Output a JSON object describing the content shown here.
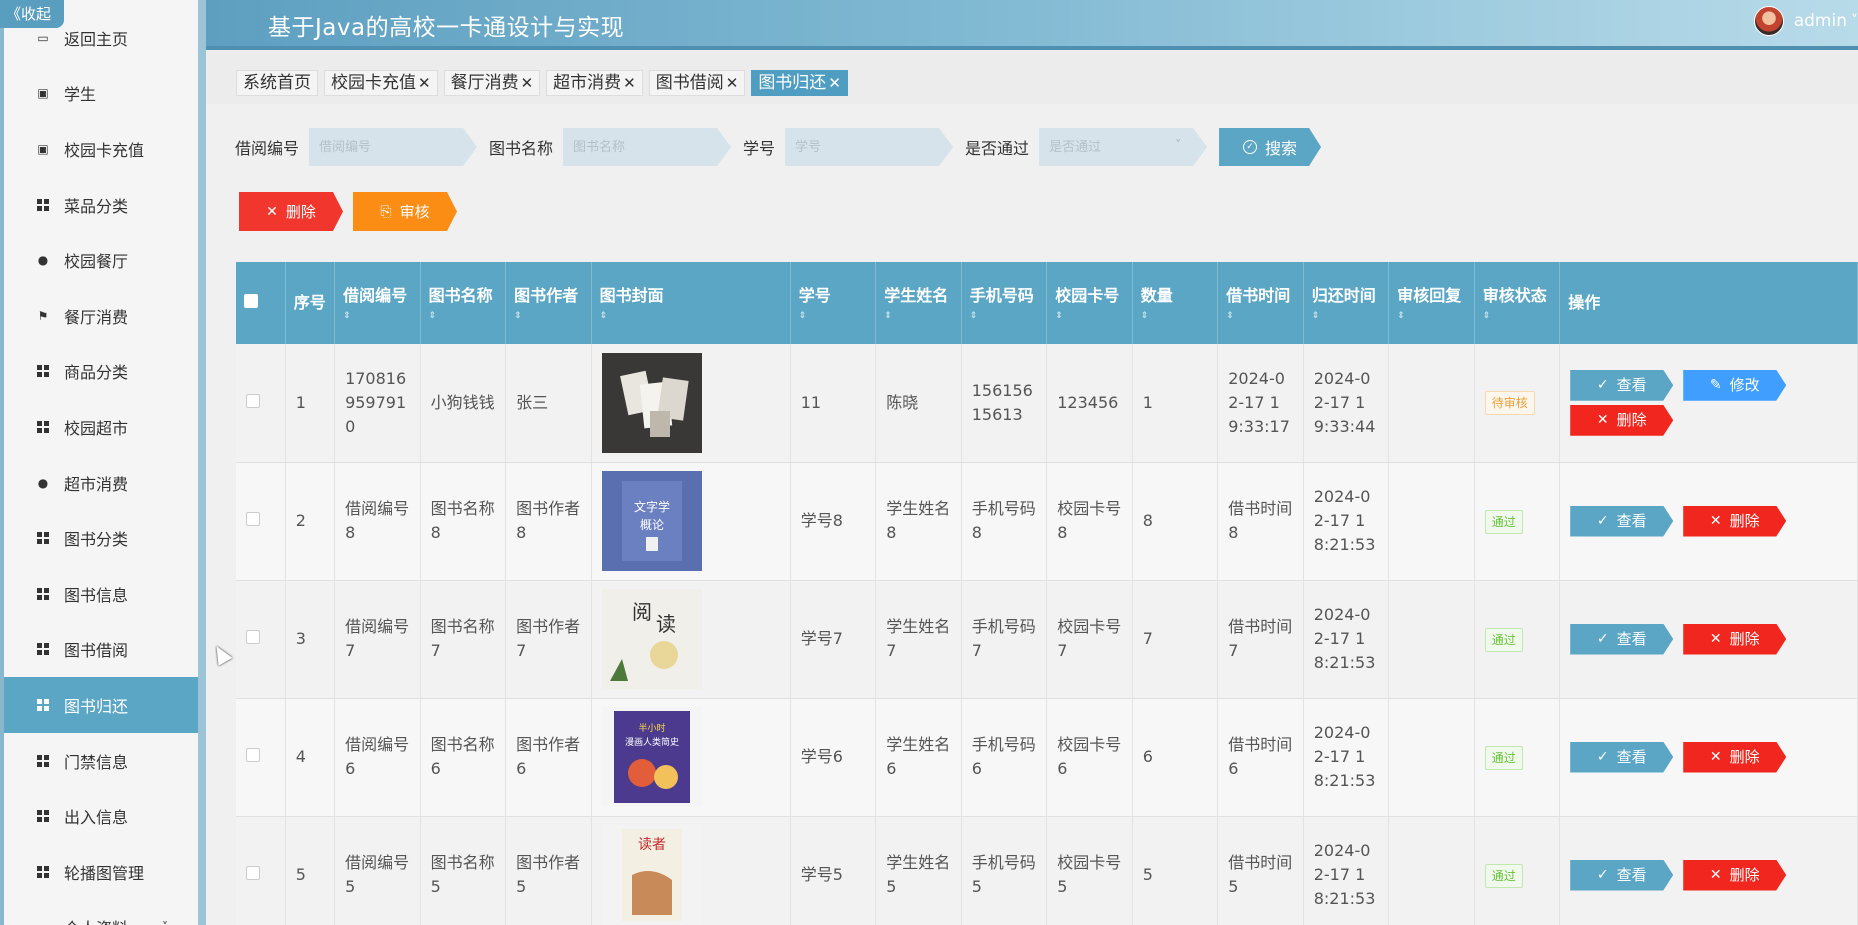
{
  "sidebar": {
    "collapse_label": "《收起",
    "items": [
      {
        "label": "返回主页",
        "icon": "home-icon"
      },
      {
        "label": "学生",
        "icon": "clipboard-check-icon"
      },
      {
        "label": "校园卡充值",
        "icon": "clipboard-x-icon"
      },
      {
        "label": "菜品分类",
        "icon": "grid-icon"
      },
      {
        "label": "校园餐厅",
        "icon": "user-icon"
      },
      {
        "label": "餐厅消费",
        "icon": "flag-icon"
      },
      {
        "label": "商品分类",
        "icon": "grid-icon"
      },
      {
        "label": "校园超市",
        "icon": "grid-icon"
      },
      {
        "label": "超市消费",
        "icon": "location-icon"
      },
      {
        "label": "图书分类",
        "icon": "grid-icon"
      },
      {
        "label": "图书信息",
        "icon": "grid-icon"
      },
      {
        "label": "图书借阅",
        "icon": "grid-icon"
      },
      {
        "label": "图书归还",
        "icon": "grid-icon",
        "active": true
      },
      {
        "label": "门禁信息",
        "icon": "grid-icon"
      },
      {
        "label": "出入信息",
        "icon": "grid-icon"
      },
      {
        "label": "轮播图管理",
        "icon": "grid-icon"
      },
      {
        "label": "个人资料",
        "icon": "profile-icon"
      }
    ]
  },
  "header": {
    "title": "基于Java的高校一卡通设计与实现",
    "username": "admin",
    "dropdown_arrow": "˅"
  },
  "tabs": [
    {
      "label": "系统首页",
      "closable": false
    },
    {
      "label": "校园卡充值",
      "closable": true
    },
    {
      "label": "餐厅消费",
      "closable": true
    },
    {
      "label": "超市消费",
      "closable": true
    },
    {
      "label": "图书借阅",
      "closable": true
    },
    {
      "label": "图书归还",
      "closable": true,
      "active": true
    }
  ],
  "tab_close": "✕",
  "search": {
    "borrow_no_label": "借阅编号",
    "borrow_no_placeholder": "借阅编号",
    "book_name_label": "图书名称",
    "book_name_placeholder": "图书名称",
    "student_no_label": "学号",
    "student_no_placeholder": "学号",
    "passed_label": "是否通过",
    "passed_placeholder": "是否通过",
    "button_label": "搜索"
  },
  "actions": {
    "delete_label": "删除",
    "review_label": "审核"
  },
  "table": {
    "headers": [
      "序号",
      "借阅编号",
      "图书名称",
      "图书作者",
      "图书封面",
      "学号",
      "学生姓名",
      "手机号码",
      "校园卡号",
      "数量",
      "借书时间",
      "归还时间",
      "审核回复",
      "审核状态",
      "操作"
    ],
    "rows": [
      {
        "index": "1",
        "borrow_no": "1708169597910",
        "book_name": "小狗钱钱",
        "author": "张三",
        "student_no": "11",
        "student_name": "陈晓",
        "phone": "15615615613",
        "card_no": "123456",
        "qty": "1",
        "borrow_time": "2024-02-17 19:33:17",
        "return_time": "2024-02-17 19:33:44",
        "reply": "",
        "status": "待审核",
        "status_type": "wait",
        "ops": [
          "view",
          "edit",
          "del"
        ]
      },
      {
        "index": "2",
        "borrow_no": "借阅编号8",
        "book_name": "图书名称8",
        "author": "图书作者8",
        "student_no": "学号8",
        "student_name": "学生姓名8",
        "phone": "手机号码8",
        "card_no": "校园卡号8",
        "qty": "8",
        "borrow_time": "借书时间8",
        "return_time": "2024-02-17 18:21:53",
        "reply": "",
        "status": "通过",
        "status_type": "pass",
        "ops": [
          "view",
          "del"
        ]
      },
      {
        "index": "3",
        "borrow_no": "借阅编号7",
        "book_name": "图书名称7",
        "author": "图书作者7",
        "student_no": "学号7",
        "student_name": "学生姓名7",
        "phone": "手机号码7",
        "card_no": "校园卡号7",
        "qty": "7",
        "borrow_time": "借书时间7",
        "return_time": "2024-02-17 18:21:53",
        "reply": "",
        "status": "通过",
        "status_type": "pass",
        "ops": [
          "view",
          "del"
        ]
      },
      {
        "index": "4",
        "borrow_no": "借阅编号6",
        "book_name": "图书名称6",
        "author": "图书作者6",
        "student_no": "学号6",
        "student_name": "学生姓名6",
        "phone": "手机号码6",
        "card_no": "校园卡号6",
        "qty": "6",
        "borrow_time": "借书时间6",
        "return_time": "2024-02-17 18:21:53",
        "reply": "",
        "status": "通过",
        "status_type": "pass",
        "ops": [
          "view",
          "del"
        ]
      },
      {
        "index": "5",
        "borrow_no": "借阅编号5",
        "book_name": "图书名称5",
        "author": "图书作者5",
        "student_no": "学号5",
        "student_name": "学生姓名5",
        "phone": "手机号码5",
        "card_no": "校园卡号5",
        "qty": "5",
        "borrow_time": "借书时间5",
        "return_time": "2024-02-17 18:21:53",
        "reply": "",
        "status": "通过",
        "status_type": "pass",
        "ops": [
          "view",
          "del"
        ]
      }
    ],
    "op_labels": {
      "view": "查看",
      "edit": "修改",
      "del": "删除"
    }
  },
  "colors": {
    "primary": "#5ba6c4",
    "danger": "#f1362e",
    "warning": "#fb8c14",
    "edit": "#409eff"
  }
}
